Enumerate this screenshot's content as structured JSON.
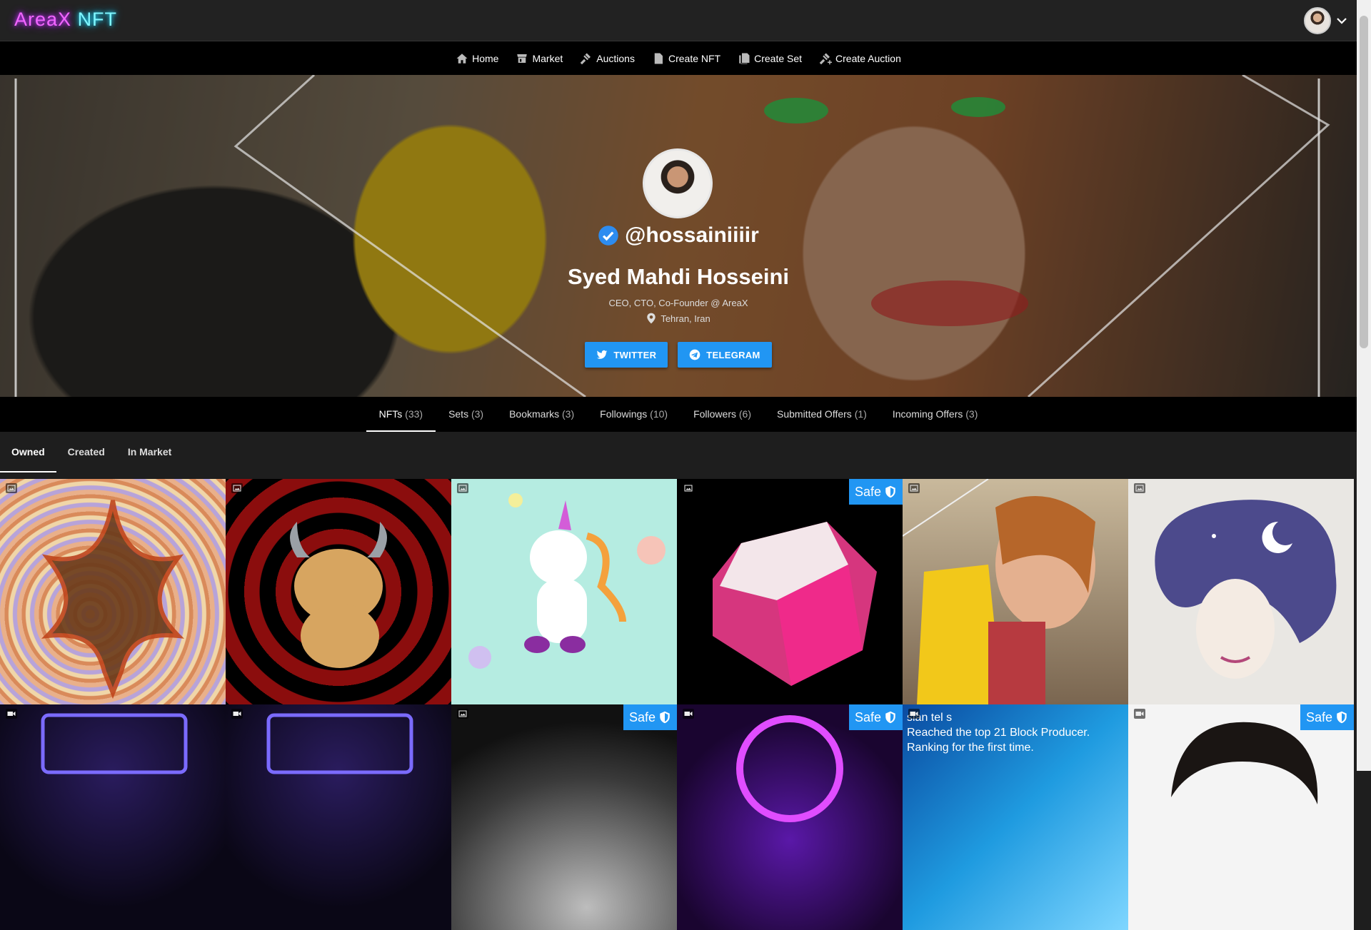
{
  "app": {
    "logo_part1": "AreaX",
    "logo_part2": "NFT"
  },
  "nav": [
    {
      "label": "Home",
      "icon": "home-icon"
    },
    {
      "label": "Market",
      "icon": "shop-icon"
    },
    {
      "label": "Auctions",
      "icon": "gavel-icon"
    },
    {
      "label": "Create NFT",
      "icon": "file-icon"
    },
    {
      "label": "Create Set",
      "icon": "files-icon"
    },
    {
      "label": "Create Auction",
      "icon": "gavel-plus-icon"
    }
  ],
  "profile": {
    "handle": "@hossainiiiir",
    "name": "Syed Mahdi Hosseini",
    "bio": "CEO, CTO, Co-Founder @ AreaX",
    "location": "Tehran, Iran",
    "twitter_label": "TWITTER",
    "telegram_label": "TELEGRAM"
  },
  "tabs": [
    {
      "label": "NFTs",
      "count": "(33)",
      "active": true
    },
    {
      "label": "Sets",
      "count": "(3)"
    },
    {
      "label": "Bookmarks",
      "count": "(3)"
    },
    {
      "label": "Followings",
      "count": "(10)"
    },
    {
      "label": "Followers",
      "count": "(6)"
    },
    {
      "label": "Submitted Offers",
      "count": "(1)"
    },
    {
      "label": "Incoming Offers",
      "count": "(3)"
    }
  ],
  "subtabs": [
    {
      "label": "Owned",
      "active": true
    },
    {
      "label": "Created"
    },
    {
      "label": "In Market"
    }
  ],
  "nfts": [
    {
      "type": "image",
      "safe": false,
      "art": "psychedelic-leaf"
    },
    {
      "type": "image",
      "safe": false,
      "art": "bull-spiral"
    },
    {
      "type": "image",
      "safe": false,
      "art": "unicorn"
    },
    {
      "type": "image",
      "safe": true,
      "art": "pink-gem"
    },
    {
      "type": "image",
      "safe": false,
      "art": "portrait-yellow"
    },
    {
      "type": "image",
      "safe": false,
      "art": "galaxy-hair"
    },
    {
      "type": "video",
      "safe": false,
      "art": "uniswap-neon"
    },
    {
      "type": "video",
      "safe": false,
      "art": "uniswap-neon"
    },
    {
      "type": "image",
      "safe": true,
      "art": "moon-surface"
    },
    {
      "type": "video",
      "safe": true,
      "art": "neon-moon"
    },
    {
      "type": "video",
      "safe": false,
      "art": "blue-announcement",
      "text": "sian tel s\nReached the top 21 Block Producer.\nRanking for the first time."
    },
    {
      "type": "video",
      "safe": true,
      "art": "portrait-dark-hair"
    }
  ],
  "safe_label": "Safe"
}
